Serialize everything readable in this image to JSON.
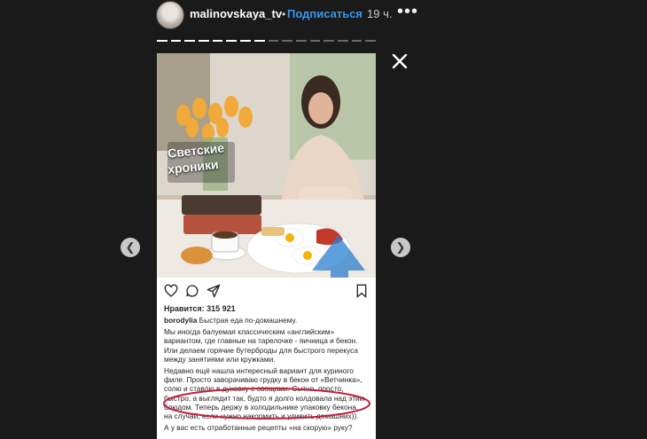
{
  "header": {
    "username": "malinovskaya_tv",
    "separator": "•",
    "follow_label": "Подписаться",
    "time": "19 ч.",
    "more_label": "•••"
  },
  "progress": {
    "segments": 16,
    "current": 8
  },
  "story": {
    "badge_line1": "Светские",
    "badge_line2": "хроники",
    "likes": "Нравится: 315 921",
    "author": "borodylia",
    "caption_first": "Быстрая еда по-домашнему.",
    "p1": "Мы иногда балуемая классическим «английским» вариантом, где главные на тарелочке - яичница и бекон. Или делаем горячие бутерброды для быстрого перекуса между занятиями или кружками.",
    "p2": "Недавно ещё нашла интересный вариант для куриного филе. Просто заворачиваю грудку в бекон от «Ветчинка», солю и ставлю в духовку с овощами. Сытно, просто, быстро, а выглядит так, будто я долго колдовала над этим блюдом. Теперь держу в холодильнике упаковку бекона, на случай, если нужно накормить и удивить домашних)).",
    "p3": "А у вас есть отработанные рецепты «на скорую» руку?"
  },
  "icons": [
    "heart-icon",
    "comment-icon",
    "share-icon",
    "bookmark-icon",
    "close-icon",
    "chevron-left-icon",
    "chevron-right-icon"
  ]
}
